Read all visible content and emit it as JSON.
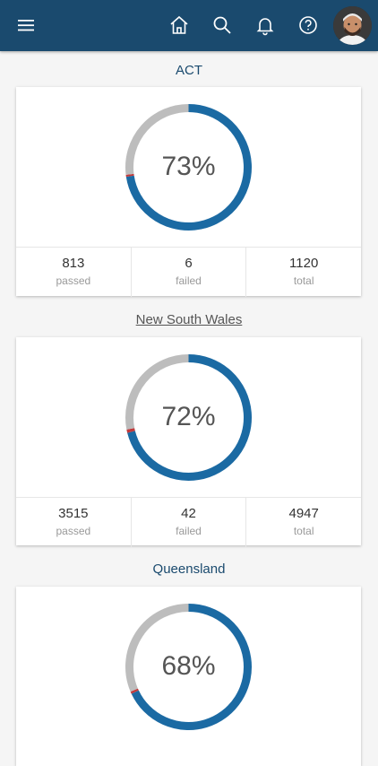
{
  "nav": {
    "menu_icon": "hamburger-menu-icon",
    "icons": [
      "home-icon",
      "search-icon",
      "bell-icon",
      "help-icon"
    ],
    "bar_color": "#1a4a6e"
  },
  "colors": {
    "passed": "#1b6aa3",
    "failed": "#c0393b",
    "remaining": "#bdbdbd"
  },
  "regions": [
    {
      "name": "ACT",
      "percent_label": "73%",
      "passed": "813",
      "failed": "6",
      "total": "1120",
      "passed_label": "passed",
      "failed_label": "failed",
      "total_label": "total",
      "passed_fraction": 0.726,
      "failed_fraction": 0.005
    },
    {
      "name": "New South Wales",
      "percent_label": "72%",
      "passed": "3515",
      "failed": "42",
      "total": "4947",
      "passed_label": "passed",
      "failed_label": "failed",
      "total_label": "total",
      "passed_fraction": 0.711,
      "failed_fraction": 0.0085
    },
    {
      "name": "Queensland",
      "percent_label": "68%",
      "passed_fraction": 0.68,
      "failed_fraction": 0.006
    }
  ]
}
